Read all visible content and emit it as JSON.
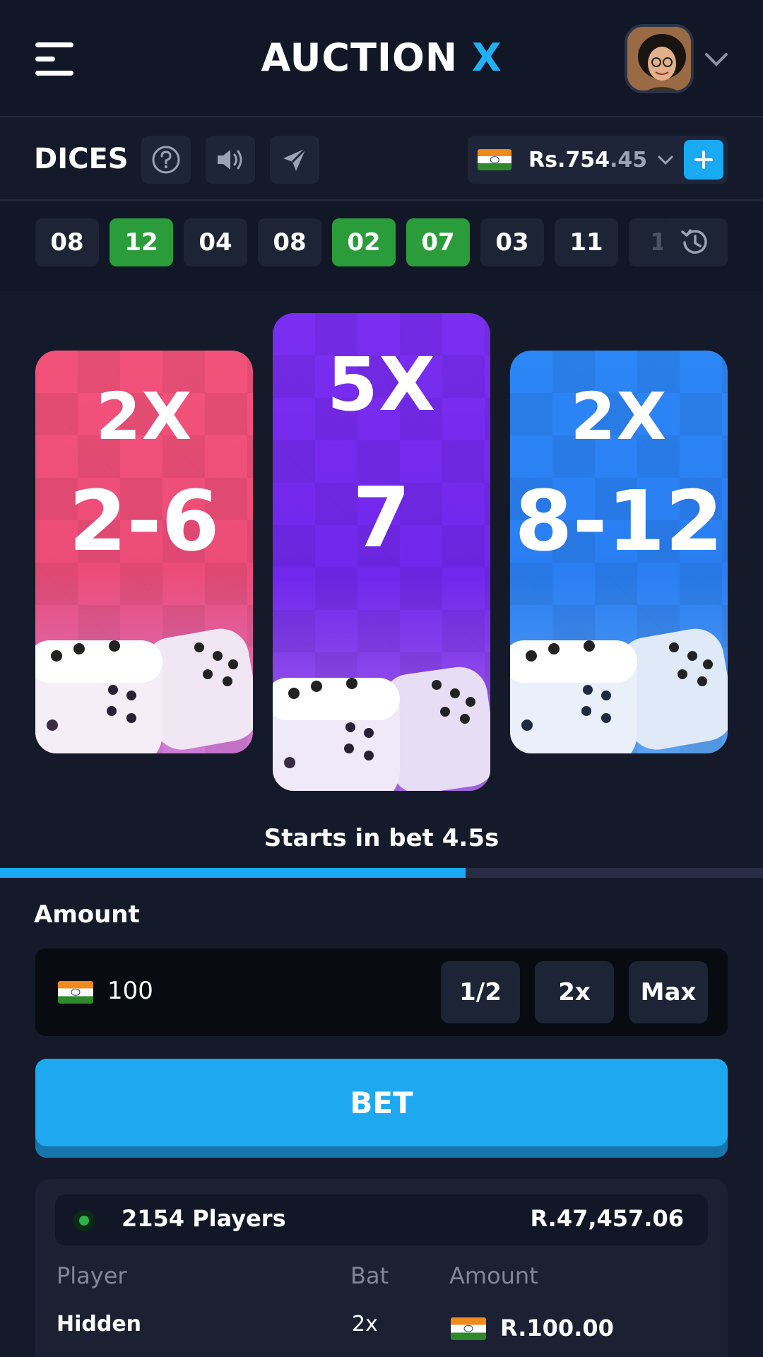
{
  "header": {
    "logo_main": "AUCTION",
    "logo_accent": "X"
  },
  "game": {
    "title": "DICES",
    "balance_main": "Rs.754",
    "balance_decimal": ".45"
  },
  "history": {
    "results": [
      {
        "value": "08",
        "win": false
      },
      {
        "value": "12",
        "win": true
      },
      {
        "value": "04",
        "win": false
      },
      {
        "value": "08",
        "win": false
      },
      {
        "value": "02",
        "win": true
      },
      {
        "value": "07",
        "win": true
      },
      {
        "value": "03",
        "win": false
      },
      {
        "value": "11",
        "win": false
      },
      {
        "value": "1",
        "win": false
      }
    ]
  },
  "cards": [
    {
      "multiplier": "2X",
      "range": "2-6",
      "color": "#f2527a"
    },
    {
      "multiplier": "5X",
      "range": "7",
      "color": "#7a2ef0"
    },
    {
      "multiplier": "2X",
      "range": "8-12",
      "color": "#2d86f5"
    }
  ],
  "timer": {
    "text": "Starts in bet 4.5s",
    "progress": 0.61
  },
  "amount": {
    "label": "Amount",
    "value": "100",
    "half_label": "1/2",
    "double_label": "2x",
    "max_label": "Max"
  },
  "bet": {
    "label": "BET"
  },
  "players": {
    "count": "2154 Players",
    "total": "R.47,457.06",
    "columns": [
      "Player",
      "Bat",
      "Amount"
    ],
    "rows": [
      {
        "player": "Hidden",
        "bet": "2x",
        "amount": "R.100.00"
      }
    ]
  },
  "colors": {
    "accent": "#1aa9f3",
    "win": "#2b9c3a",
    "background": "#141a2a"
  }
}
